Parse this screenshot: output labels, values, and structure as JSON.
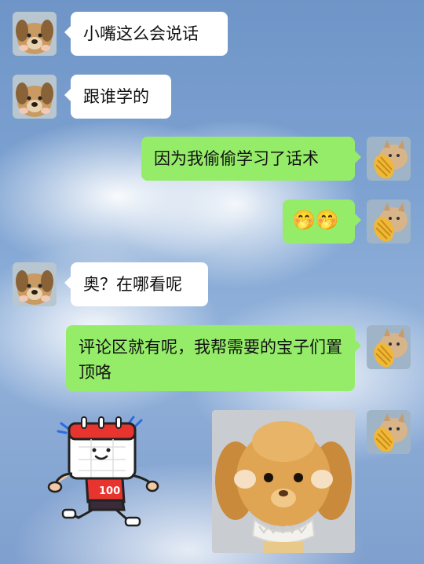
{
  "messages": [
    {
      "side": "left",
      "text": "小嘴这么会说话"
    },
    {
      "side": "left",
      "text": "跟谁学的"
    },
    {
      "side": "right",
      "text": "因为我偷偷学习了话术"
    },
    {
      "side": "right",
      "text": "🤭🤭"
    },
    {
      "side": "left",
      "text": "奥？在哪看呢"
    },
    {
      "side": "right",
      "text": "评论区就有呢，我帮需要的宝子们置顶咯"
    }
  ],
  "stickers": {
    "runner_badge": "100"
  },
  "icons": {
    "left_avatar": "puppy-avatar-icon",
    "right_avatar": "cat-avatar-icon",
    "left_sticker": "running-calendar-sticker",
    "right_sticker": "plush-puppy-sticker"
  },
  "colors": {
    "bubble_left": "#ffffff",
    "bubble_right": "#95ec69"
  }
}
